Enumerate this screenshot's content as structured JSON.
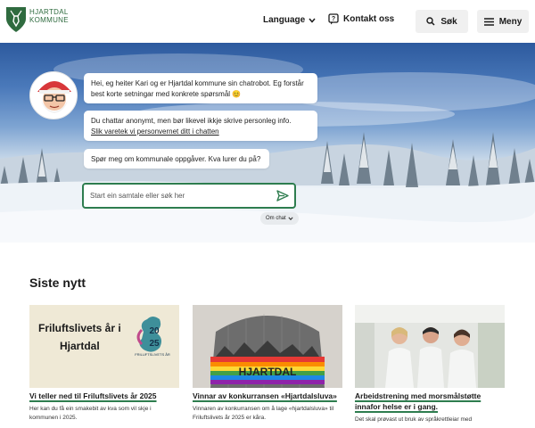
{
  "header": {
    "logo_line1": "HJARTDAL",
    "logo_line2": "KOMMUNE",
    "language_label": "Language",
    "contact_label": "Kontakt oss",
    "search_label": "Søk",
    "menu_label": "Meny"
  },
  "chat": {
    "bubble1": "Hei, eg heiter Kari og er Hjartdal kommune sin chatrobot. Eg forstår best korte setningar med konkrete spørsmål 😊",
    "bubble2_text": "Du chattar anonymt, men bør likevel ikkje skrive personleg info.",
    "bubble2_link": "Slik varetek vi personvernet ditt i chatten",
    "bubble3": "Spør meg om kommunale oppgåver. Kva lurer du på?",
    "input_placeholder": "Start ein samtale eller søk her",
    "about_chat": "Om chat"
  },
  "news": {
    "title": "Siste nytt",
    "cards": [
      {
        "image_text_line1": "Friluftslivets år i",
        "image_text_line2": "Hjartdal",
        "badge_year_top": "20",
        "badge_year_bottom": "25",
        "badge_caption": "FRILUFTSLIVETS ÅR",
        "title": "Vi teller ned til Friluftslivets år 2025",
        "desc": "Her kan du få ein smakebit av kva som vil skje i kommunen i 2025."
      },
      {
        "image_text": "HJARTDAL",
        "title": "Vinnar av konkurransen «Hjartdalsluva»",
        "desc": "Vinnaren av konkurransen om å lage «hjartdalsluva» til Friluftslivets år 2025 er kåra."
      },
      {
        "title": "Arbeidstrening med morsmålstøtte innafor helse er i gang.",
        "desc": "Det skal prøvast ut bruk av språkrettleiar med"
      }
    ]
  },
  "colors": {
    "brand_green": "#2e7d4f",
    "header_button_bg": "#f0f0f0"
  }
}
